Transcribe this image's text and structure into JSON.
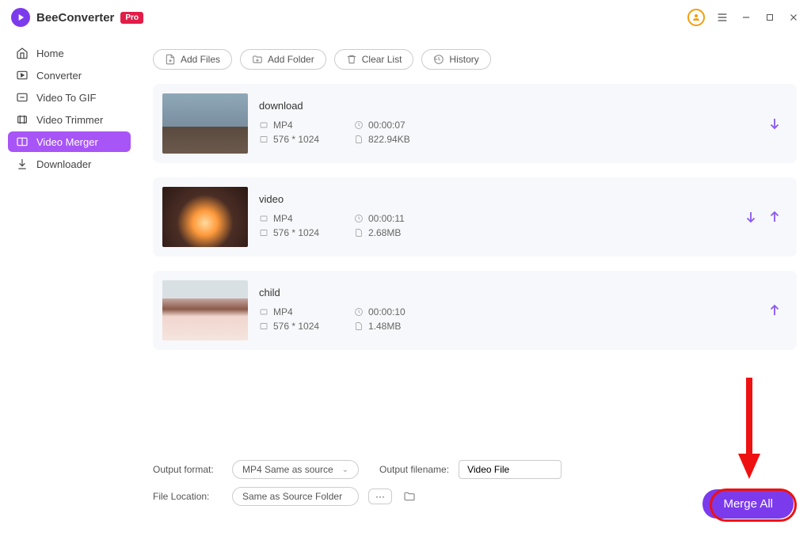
{
  "app": {
    "name": "BeeConverter",
    "badge": "Pro"
  },
  "sidebar": {
    "items": [
      {
        "label": "Home"
      },
      {
        "label": "Converter"
      },
      {
        "label": "Video To GIF"
      },
      {
        "label": "Video Trimmer"
      },
      {
        "label": "Video Merger"
      },
      {
        "label": "Downloader"
      }
    ]
  },
  "toolbar": {
    "add_files": "Add Files",
    "add_folder": "Add Folder",
    "clear_list": "Clear List",
    "history": "History"
  },
  "files": [
    {
      "title": "download",
      "format": "MP4",
      "duration": "00:00:07",
      "resolution": "576 * 1024",
      "size": "822.94KB"
    },
    {
      "title": "video",
      "format": "MP4",
      "duration": "00:00:11",
      "resolution": "576 * 1024",
      "size": "2.68MB"
    },
    {
      "title": "child",
      "format": "MP4",
      "duration": "00:00:10",
      "resolution": "576 * 1024",
      "size": "1.48MB"
    }
  ],
  "bottom": {
    "output_format_label": "Output format:",
    "output_format_value": "MP4 Same as source",
    "output_filename_label": "Output filename:",
    "output_filename_value": "Video File",
    "file_location_label": "File Location:",
    "file_location_value": "Same as Source Folder",
    "merge_button": "Merge All"
  }
}
